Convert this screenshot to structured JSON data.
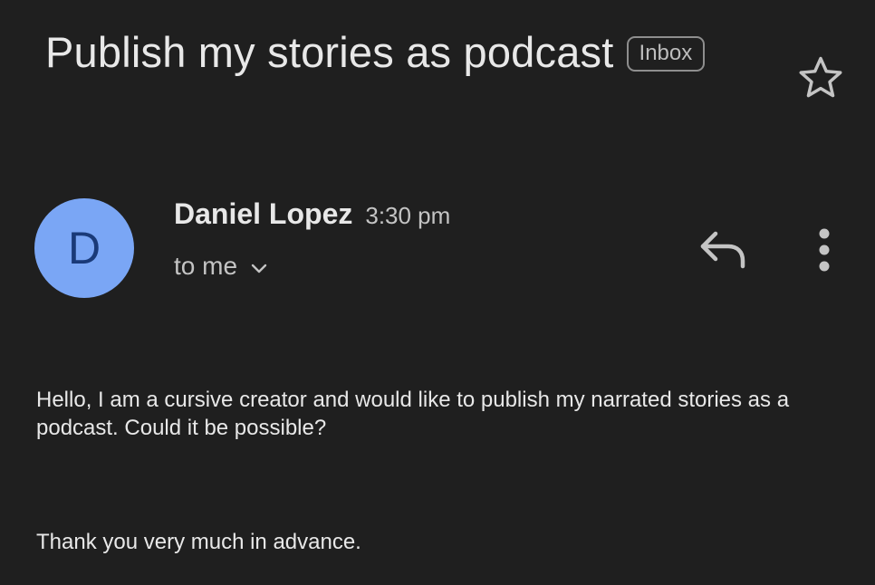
{
  "email": {
    "subject": "Publish my stories as podcast",
    "label": "Inbox",
    "sender": {
      "initial": "D",
      "name": "Daniel Lopez",
      "time": "3:30 pm",
      "recipient": "to me",
      "avatar_color": "#7aa6f5"
    },
    "body": {
      "paragraph_1": "Hello, I am a cursive creator and would like to publish my narrated stories as a podcast. Could it be possible?",
      "paragraph_2": "Thank you very much in advance."
    }
  },
  "icons": {
    "star": "star-outline-icon",
    "reply": "reply-icon",
    "more": "more-vertical-icon",
    "expand": "chevron-down-icon"
  },
  "theme": {
    "background": "#1f1f1f",
    "text": "#e8e8e8"
  }
}
